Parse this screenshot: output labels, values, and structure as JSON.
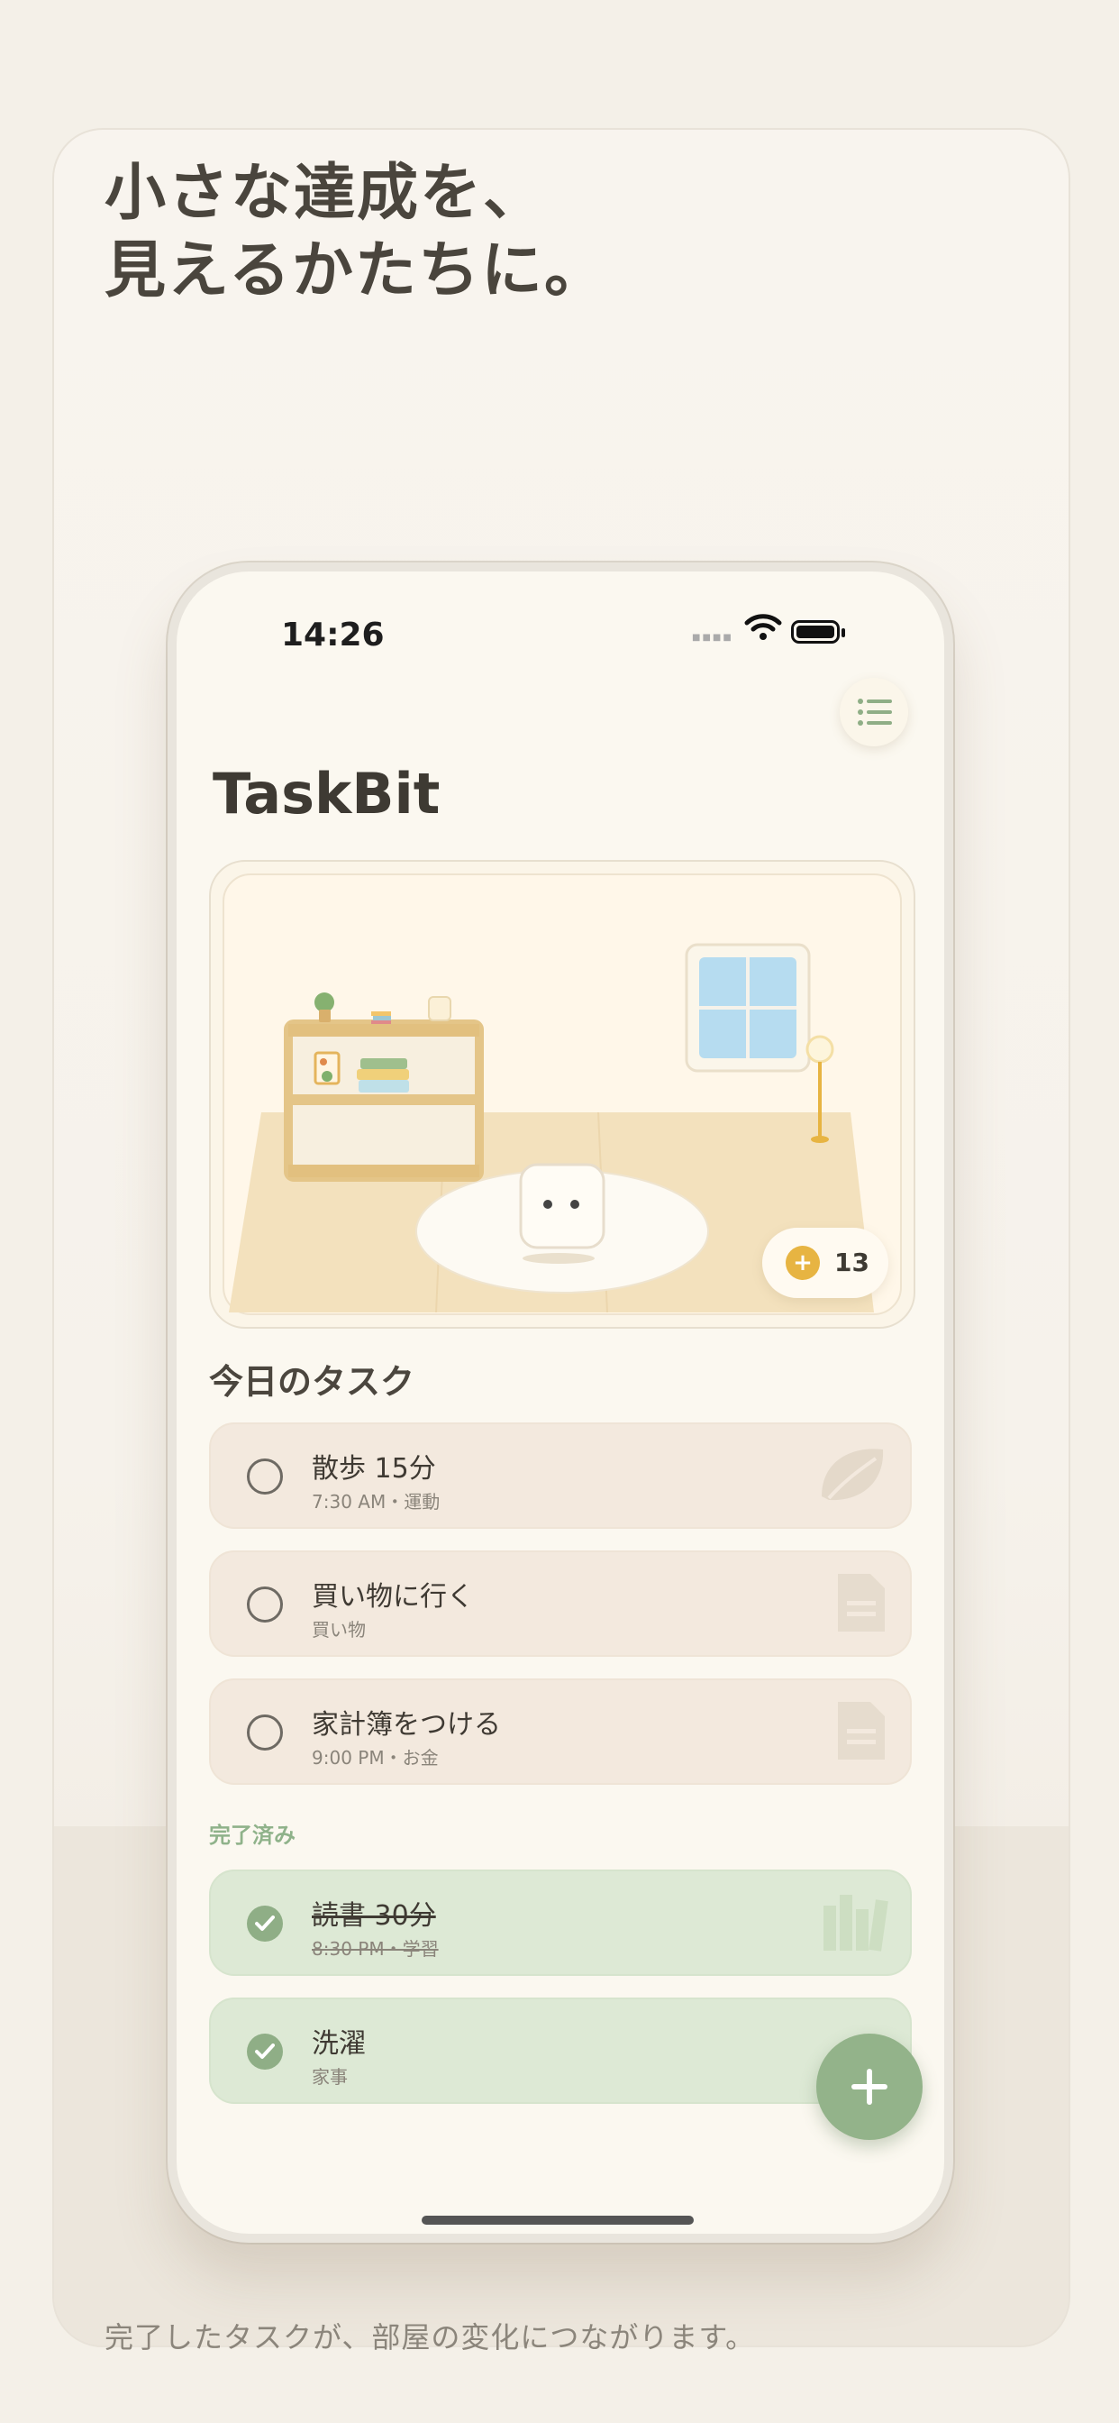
{
  "headline": {
    "line1": "小さな達成を、",
    "line2": "見えるかたちに。"
  },
  "caption": "完了したタスクが、部屋の変化につながります。",
  "status_bar": {
    "time": "14:26"
  },
  "app": {
    "title": "TaskBit",
    "coins": "13",
    "icons": {
      "menu": "list-icon",
      "coin": "coin-icon",
      "add": "plus-icon"
    }
  },
  "today": {
    "title": "今日のタスク",
    "tasks": [
      {
        "title": "散歩 15分",
        "subtitle": "7:30 AM・運動",
        "icon": "leaf-icon"
      },
      {
        "title": "買い物に行く",
        "subtitle": "買い物",
        "icon": "document-icon"
      },
      {
        "title": "家計簿をつける",
        "subtitle": "9:00 PM・お金",
        "icon": "document-icon"
      }
    ]
  },
  "completed": {
    "title": "完了済み",
    "tasks": [
      {
        "title": "読書 30分",
        "subtitle": "8:30 PM・学習",
        "icon": "books-icon"
      },
      {
        "title": "洗濯",
        "subtitle": "家事",
        "icon": "shirt-icon"
      }
    ]
  },
  "colors": {
    "background": "#f4f0e8",
    "screen": "#fbf8f0",
    "pending_task": "#f3e9de",
    "done_task": "#dde9d5",
    "accent_green": "#93b38a",
    "coin": "#e7b442",
    "window_glass": "#b6dcf0"
  }
}
